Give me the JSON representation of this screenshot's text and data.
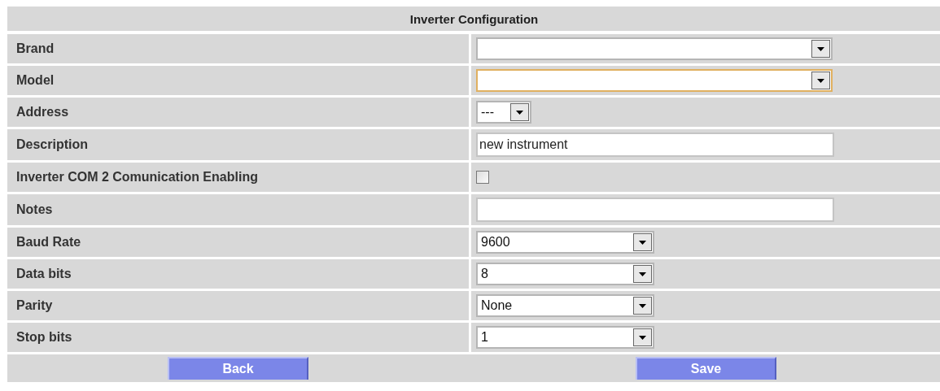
{
  "title": "Inverter Configuration",
  "rows": [
    {
      "label": "Brand",
      "field": {
        "kind": "wide-select",
        "focused": false
      }
    },
    {
      "label": "Model",
      "field": {
        "kind": "wide-select",
        "focused": true
      }
    },
    {
      "label": "Address",
      "field": {
        "kind": "short-select",
        "value": "---",
        "focused": false
      }
    },
    {
      "label": "Description",
      "field": {
        "kind": "text",
        "value": "new instrument"
      }
    },
    {
      "label": "Inverter COM 2 Comunication Enabling",
      "field": {
        "kind": "checkbox",
        "checked": false
      }
    },
    {
      "label": "Notes",
      "field": {
        "kind": "text"
      }
    },
    {
      "label": "Baud Rate",
      "field": {
        "kind": "select",
        "value": "9600",
        "focused": false
      }
    },
    {
      "label": "Data bits",
      "field": {
        "kind": "select",
        "value": "8",
        "focused": false
      }
    },
    {
      "label": "Parity",
      "field": {
        "kind": "select",
        "value": "None",
        "focused": false
      }
    },
    {
      "label": "Stop bits",
      "field": {
        "kind": "select",
        "value": "1",
        "focused": false
      }
    }
  ],
  "buttons": [
    "Back",
    "Save"
  ]
}
